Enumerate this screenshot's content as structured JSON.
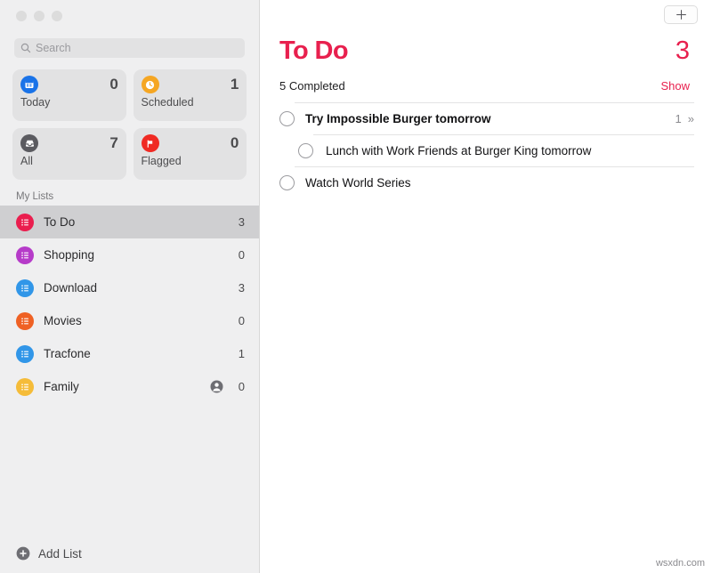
{
  "window": {
    "traffic_lights": [
      "close-button",
      "minimize-button",
      "zoom-button"
    ]
  },
  "colors": {
    "accent_red": "#e8204e",
    "sidebar_bg": "#efeff0",
    "selected_row": "#cfcfd1",
    "today_blue": "#1a73e8",
    "scheduled_orange": "#f5a623",
    "all_gray": "#5b5b60",
    "flagged_red": "#f02a23"
  },
  "sidebar": {
    "search": {
      "placeholder": "Search",
      "value": ""
    },
    "smart_lists": [
      {
        "label": "Today",
        "count": "0",
        "icon": "calendar-icon",
        "color": "#1a73e8"
      },
      {
        "label": "Scheduled",
        "count": "1",
        "icon": "clock-icon",
        "color": "#f5a623"
      },
      {
        "label": "All",
        "count": "7",
        "icon": "tray-icon",
        "color": "#5b5b60"
      },
      {
        "label": "Flagged",
        "count": "0",
        "icon": "flag-icon",
        "color": "#f02a23"
      }
    ],
    "section_title": "My Lists",
    "lists": [
      {
        "label": "To Do",
        "count": "3",
        "color": "#ea1e4e",
        "selected": true,
        "shared": false
      },
      {
        "label": "Shopping",
        "count": "0",
        "color": "#b63bc9",
        "selected": false,
        "shared": false
      },
      {
        "label": "Download",
        "count": "3",
        "color": "#3196e8",
        "selected": false,
        "shared": false
      },
      {
        "label": "Movies",
        "count": "0",
        "color": "#ef6124",
        "selected": false,
        "shared": false
      },
      {
        "label": "Tracfone",
        "count": "1",
        "color": "#3196e8",
        "selected": false,
        "shared": false
      },
      {
        "label": "Family",
        "count": "0",
        "color": "#f5bc39",
        "selected": false,
        "shared": true
      }
    ],
    "add_list_label": "Add List"
  },
  "main": {
    "add_reminder_label": "+",
    "title": "To Do",
    "total_count": "3",
    "completed_label": "5 Completed",
    "show_label": "Show",
    "tasks": [
      {
        "title": "Try Impossible Burger tomorrow",
        "level": 0,
        "bold": true,
        "completed": false,
        "subtask_count": "1",
        "chevron": "»"
      },
      {
        "title": "Lunch with Work Friends at Burger King tomorrow",
        "level": 1,
        "bold": false,
        "completed": false,
        "subtask_count": "",
        "chevron": ""
      },
      {
        "title": "Watch World Series",
        "level": 0,
        "bold": false,
        "completed": false,
        "subtask_count": "",
        "chevron": ""
      }
    ]
  },
  "watermark": "wsxdn.com"
}
